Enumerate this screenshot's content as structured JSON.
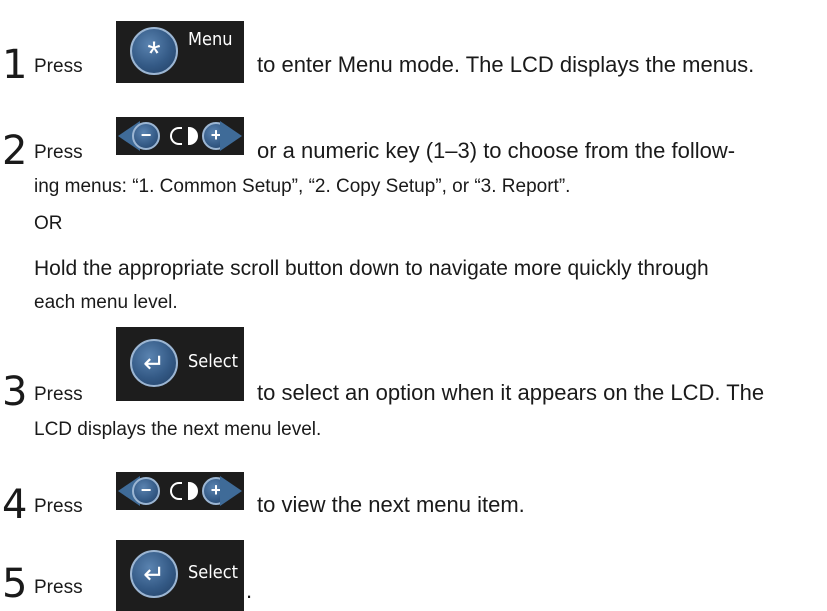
{
  "steps": [
    {
      "number": "1",
      "press": "Press",
      "button": {
        "icon": "asterisk-icon",
        "glyph": "*",
        "label": "Menu"
      },
      "text": "to enter Menu mode. The LCD displays the menus."
    },
    {
      "number": "2",
      "press": "Press",
      "button": {
        "icon": "scroll-buttons-icon",
        "minus": "−",
        "plus": "+"
      },
      "text_line1": "or a numeric key (1–3) to choose from the follow-",
      "text_line2": "ing menus: “1. Common Setup”, “2. Copy Setup”, or “3. Report”.",
      "or": "OR",
      "hold_line1": "Hold the appropriate scroll button down to navigate more quickly through",
      "hold_line2": "each menu level."
    },
    {
      "number": "3",
      "press": "Press",
      "button": {
        "icon": "enter-icon",
        "glyph": "↵",
        "label": "Select"
      },
      "text_line1": "to select an option when it appears on the LCD. The",
      "text_line2": "LCD displays the next menu level."
    },
    {
      "number": "4",
      "press": "Press",
      "button": {
        "icon": "scroll-buttons-icon",
        "minus": "−",
        "plus": "+"
      },
      "text": "to view the next menu item."
    },
    {
      "number": "5",
      "press": "Press",
      "button": {
        "icon": "enter-icon",
        "glyph": "↵",
        "label": "Select"
      },
      "text": "."
    }
  ]
}
